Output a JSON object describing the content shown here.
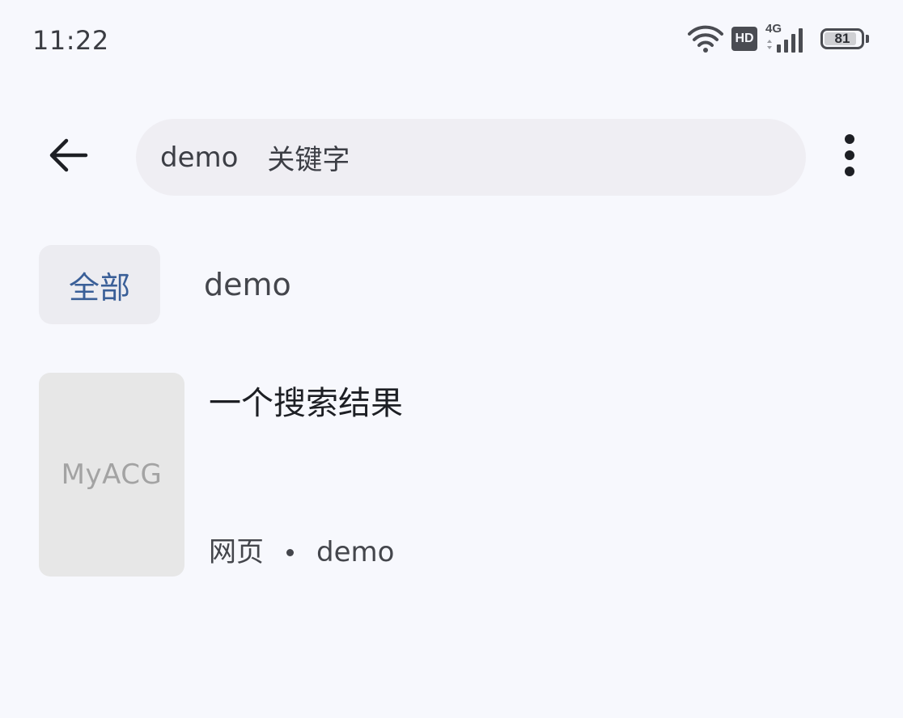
{
  "status_bar": {
    "time": "11:22",
    "network_type": "4G",
    "hd_label": "HD",
    "battery_level": "81",
    "icons": [
      "wifi-icon",
      "hd-icon",
      "cellular-signal-icon",
      "battery-icon"
    ]
  },
  "search": {
    "query_source": "demo",
    "query_keyword": "关键字"
  },
  "filter": {
    "chip_label": "全部",
    "source_label": "demo"
  },
  "results": [
    {
      "cover_text": "MyACG",
      "title": "一个搜索结果",
      "type": "网页",
      "source": "demo"
    }
  ],
  "colors": {
    "background": "#f7f8fd",
    "search_box": "#efeef3",
    "chip_background": "#ececf1",
    "chip_text": "#3a5f98",
    "cover_background": "#e7e7e7"
  }
}
